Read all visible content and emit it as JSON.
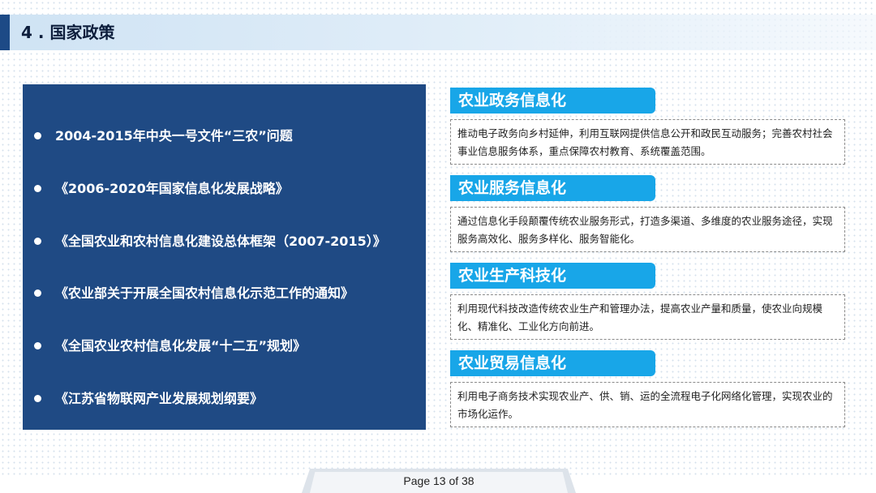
{
  "header": {
    "title": "4 . 国家政策"
  },
  "policies": [
    "2004-2015年中央一号文件“三农”问题",
    "《2006-2020年国家信息化发展战略》",
    "《全国农业和农村信息化建设总体框架（2007-2015）》",
    "《农业部关于开展全国农村信息化示范工作的通知》",
    "《全国农业农村信息化发展“十二五”规划》",
    "《江苏省物联网产业发展规划纲要》"
  ],
  "categories": [
    {
      "title": "农业政务信息化",
      "description": "推动电子政务向乡村延伸，利用互联网提供信息公开和政民互动服务；完善农村社会事业信息服务体系，重点保障农村教育、系统覆盖范围。"
    },
    {
      "title": "农业服务信息化",
      "description": "通过信息化手段颠覆传统农业服务形式，打造多渠道、多维度的农业服务途径，实现服务高效化、服务多样化、服务智能化。"
    },
    {
      "title": "农业生产科技化",
      "description": "利用现代科技改造传统农业生产和管理办法，提高农业产量和质量，使农业向规模化、精准化、工业化方向前进。"
    },
    {
      "title": "农业贸易信息化",
      "description": "利用电子商务技术实现农业产、供、销、运的全流程电子化网络化管理，实现农业的市场化运作。"
    }
  ],
  "footer": {
    "page": "Page 13 of 38"
  },
  "colors": {
    "panel": "#1f4a84",
    "accent": "#18a6e8",
    "header_accent": "#1d4a86"
  }
}
